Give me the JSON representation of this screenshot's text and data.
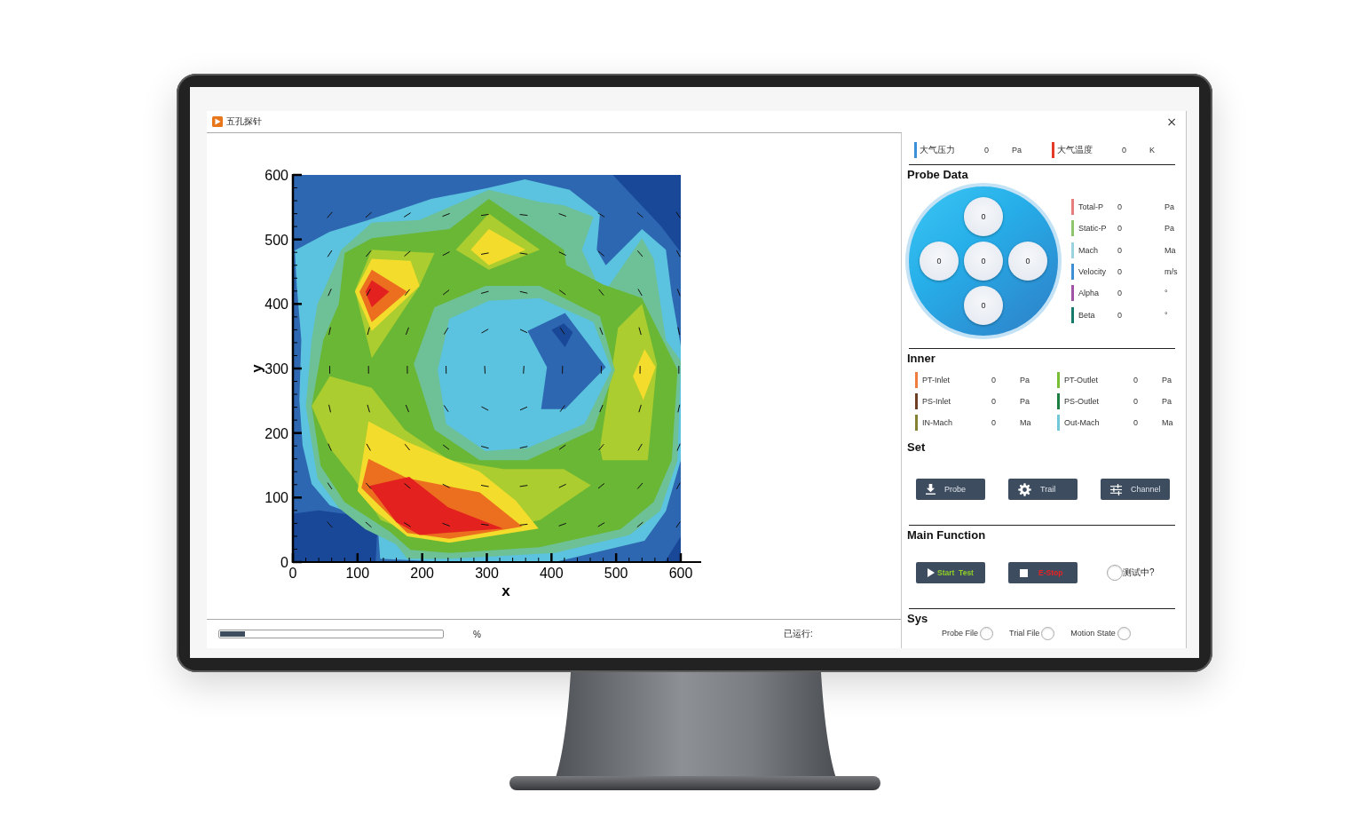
{
  "window": {
    "title": "五孔探针",
    "close": "×"
  },
  "plot": {
    "xlabel": "x",
    "ylabel": "y",
    "xticks": [
      "0",
      "100",
      "200",
      "300",
      "400",
      "500",
      "600"
    ],
    "yticks": [
      "600",
      "500",
      "400",
      "300",
      "200",
      "100",
      "0"
    ]
  },
  "status_bar": {
    "progress": {
      "level": 0.11
    },
    "percent": "%",
    "elapsed_label": "已运行:"
  },
  "ambient": [
    {
      "label": "大气压力",
      "value": "0",
      "unit": "Pa",
      "color": "#3a90d8"
    },
    {
      "label": "大气温度",
      "value": "0",
      "unit": "K",
      "color": "#e23a26"
    }
  ],
  "probe_data": {
    "title": "Probe Data",
    "holes": [
      "0",
      "0",
      "0",
      "0",
      "0"
    ],
    "readings": [
      {
        "label": "Total-P",
        "value": "0",
        "unit": "Pa",
        "color": "#e87d7d"
      },
      {
        "label": "Static-P",
        "value": "0",
        "unit": "Pa",
        "color": "#8ec46b"
      },
      {
        "label": "Mach",
        "value": "0",
        "unit": "Ma",
        "color": "#9ad3df"
      },
      {
        "label": "Velocity",
        "value": "0",
        "unit": "m/s",
        "color": "#3d8fd3"
      },
      {
        "label": "Alpha",
        "value": "0",
        "unit": "°",
        "color": "#a052a4"
      },
      {
        "label": "Beta",
        "value": "0",
        "unit": "°",
        "color": "#157a6c"
      }
    ]
  },
  "inner": {
    "title": "Inner",
    "items": [
      {
        "label": "PT-Inlet",
        "value": "0",
        "unit": "Pa",
        "color": "#ef7d3e"
      },
      {
        "label": "PT-Outlet",
        "value": "0",
        "unit": "Pa",
        "color": "#77be34"
      },
      {
        "label": "PS-Inlet",
        "value": "0",
        "unit": "Pa",
        "color": "#6e3f22"
      },
      {
        "label": "PS-Outlet",
        "value": "0",
        "unit": "Pa",
        "color": "#1b7d3f"
      },
      {
        "label": "IN-Mach",
        "value": "0",
        "unit": "Ma",
        "color": "#848232"
      },
      {
        "label": "Out-Mach",
        "value": "0",
        "unit": "Ma",
        "color": "#72c7d9"
      }
    ]
  },
  "set": {
    "title": "Set",
    "buttons": [
      {
        "label": "Probe",
        "kind": "download"
      },
      {
        "label": "Trail",
        "kind": "gear"
      },
      {
        "label": "Channel",
        "kind": "sliders"
      }
    ]
  },
  "main_function": {
    "title": "Main Function",
    "buttons": [
      {
        "label": "Start  Test",
        "kind": "start"
      },
      {
        "label": "E-Stop",
        "kind": "stop"
      }
    ],
    "indicator": {
      "label": "测试中?",
      "on": false
    }
  },
  "sys": {
    "title": "Sys",
    "indicators": [
      {
        "label": "Probe File",
        "on": false
      },
      {
        "label": "Trial File",
        "on": false
      },
      {
        "label": "Motion State",
        "on": false
      }
    ]
  }
}
